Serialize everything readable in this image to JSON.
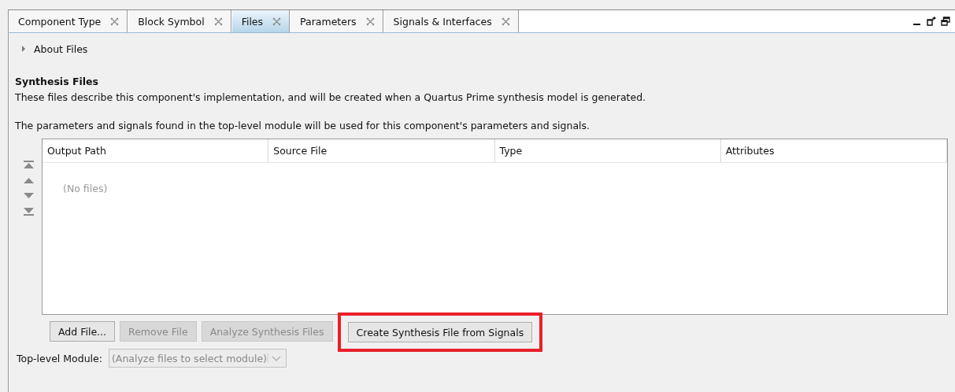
{
  "tabs": [
    {
      "label": "Component Type",
      "selected": false
    },
    {
      "label": "Block Symbol",
      "selected": false
    },
    {
      "label": "Files",
      "selected": true
    },
    {
      "label": "Parameters",
      "selected": false
    },
    {
      "label": "Signals & Interfaces",
      "selected": false
    }
  ],
  "about": {
    "label": "About Files",
    "expanded": false
  },
  "section": {
    "title": "Synthesis Files",
    "description": "These files describe this component's implementation, and will be created when a Quartus Prime synthesis model is generated.",
    "note": "The parameters and signals found in the top-level module will be used for this component's parameters and signals."
  },
  "table": {
    "columns": [
      "Output Path",
      "Source File",
      "Type",
      "Attributes"
    ],
    "empty_text": "(No files)"
  },
  "buttons": [
    {
      "label": "Add File...",
      "disabled": false,
      "highlighted": false
    },
    {
      "label": "Remove File",
      "disabled": true,
      "highlighted": false
    },
    {
      "label": "Analyze Synthesis Files",
      "disabled": true,
      "highlighted": false
    },
    {
      "label": "Create Synthesis File from Signals",
      "disabled": false,
      "highlighted": true
    }
  ],
  "top_level_module": {
    "label": "Top-level Module:",
    "placeholder": "(Analyze files to select module)",
    "disabled": true
  }
}
